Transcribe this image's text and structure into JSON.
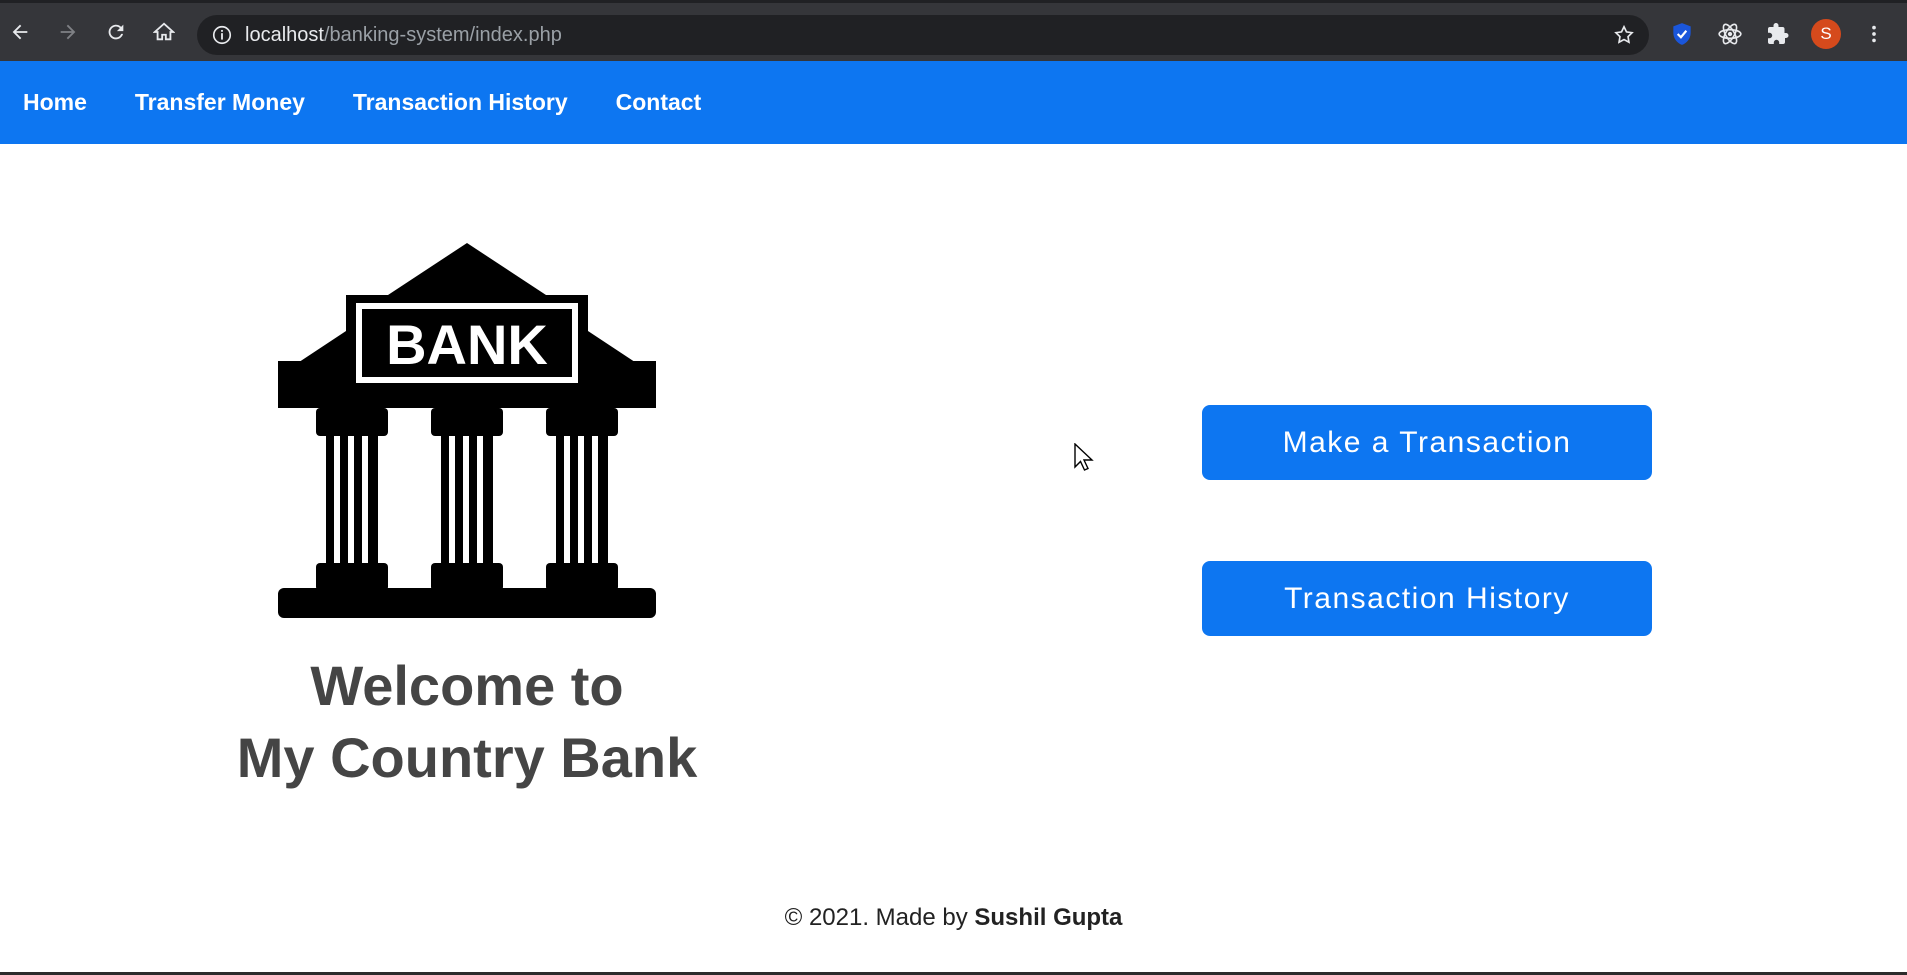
{
  "browser": {
    "url_host": "localhost",
    "url_path": "/banking-system/index.php",
    "avatar_letter": "S"
  },
  "nav": {
    "items": [
      {
        "label": "Home"
      },
      {
        "label": "Transfer Money"
      },
      {
        "label": "Transaction History"
      },
      {
        "label": "Contact"
      }
    ]
  },
  "hero": {
    "logo_text": "BANK",
    "welcome_line1": "Welcome to",
    "welcome_line2": "My Country Bank"
  },
  "actions": {
    "make_transaction": "Make a Transaction",
    "transaction_history": "Transaction History"
  },
  "footer": {
    "prefix": "© 2021. Made by ",
    "author": "Sushil Gupta"
  },
  "colors": {
    "primary": "#0d76f1",
    "heading": "#454545"
  }
}
